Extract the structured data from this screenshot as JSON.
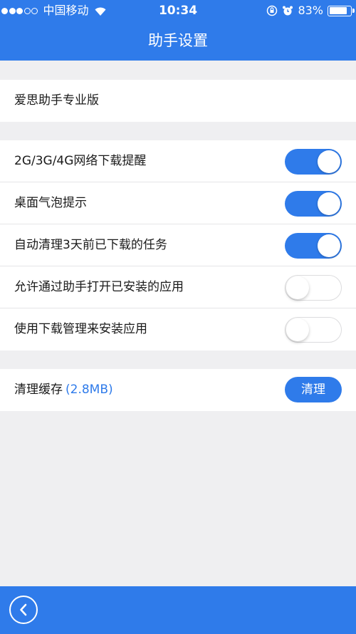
{
  "status_bar": {
    "carrier": "中国移动",
    "time": "10:34",
    "battery_percent": "83%",
    "battery_level": 0.83,
    "signal_bars_full": 3,
    "signal_bars_total": 5
  },
  "header": {
    "title": "助手设置"
  },
  "account": {
    "label": "爱思助手专业版"
  },
  "settings": [
    {
      "label": "2G/3G/4G网络下载提醒",
      "enabled": true
    },
    {
      "label": "桌面气泡提示",
      "enabled": true
    },
    {
      "label": "自动清理3天前已下载的任务",
      "enabled": true
    },
    {
      "label": "允许通过助手打开已安装的应用",
      "enabled": false
    },
    {
      "label": "使用下载管理来安装应用",
      "enabled": false
    }
  ],
  "cache": {
    "label": "清理缓存",
    "size": "(2.8MB)",
    "button_label": "清理"
  },
  "colors": {
    "accent": "#2f7bea",
    "background": "#efeff1"
  },
  "icons": {
    "back": "chevron-left-icon",
    "wifi": "wifi-icon",
    "alarm": "alarm-icon",
    "lock": "orientation-lock-icon"
  }
}
